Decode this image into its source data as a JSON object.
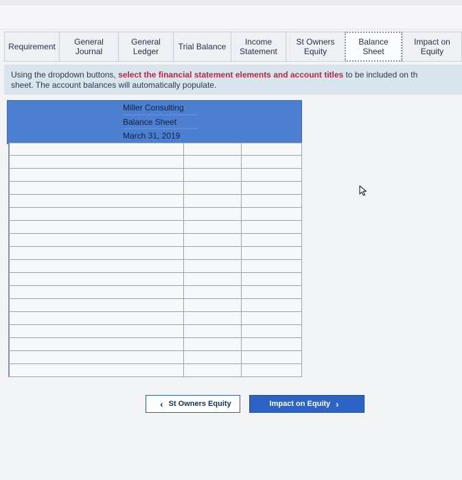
{
  "tabs": [
    {
      "label": "Requirement"
    },
    {
      "label": "General Journal"
    },
    {
      "label": "General Ledger"
    },
    {
      "label": "Trial Balance"
    },
    {
      "label": "Income Statement"
    },
    {
      "label": "St Owners Equity"
    },
    {
      "label": "Balance Sheet",
      "active": true
    },
    {
      "label": "Impact on Equity"
    }
  ],
  "instructions": {
    "prefix": "Using the dropdown buttons, ",
    "highlight": "select the financial statement elements and account titles",
    "suffix": " to be included on th",
    "line2": "sheet.  The account balances will automatically populate."
  },
  "statement": {
    "company": "Miller Consulting",
    "title": "Balance Sheet",
    "date": "March 31, 2019"
  },
  "row_count": 18,
  "nav": {
    "prev_label": "St Owners Equity",
    "next_label": "Impact on Equity"
  },
  "colors": {
    "accent": "#2d63c4",
    "header_blue": "#4d7fd1",
    "highlight_red": "#c2243d",
    "instr_bg": "#d8e5ec"
  }
}
